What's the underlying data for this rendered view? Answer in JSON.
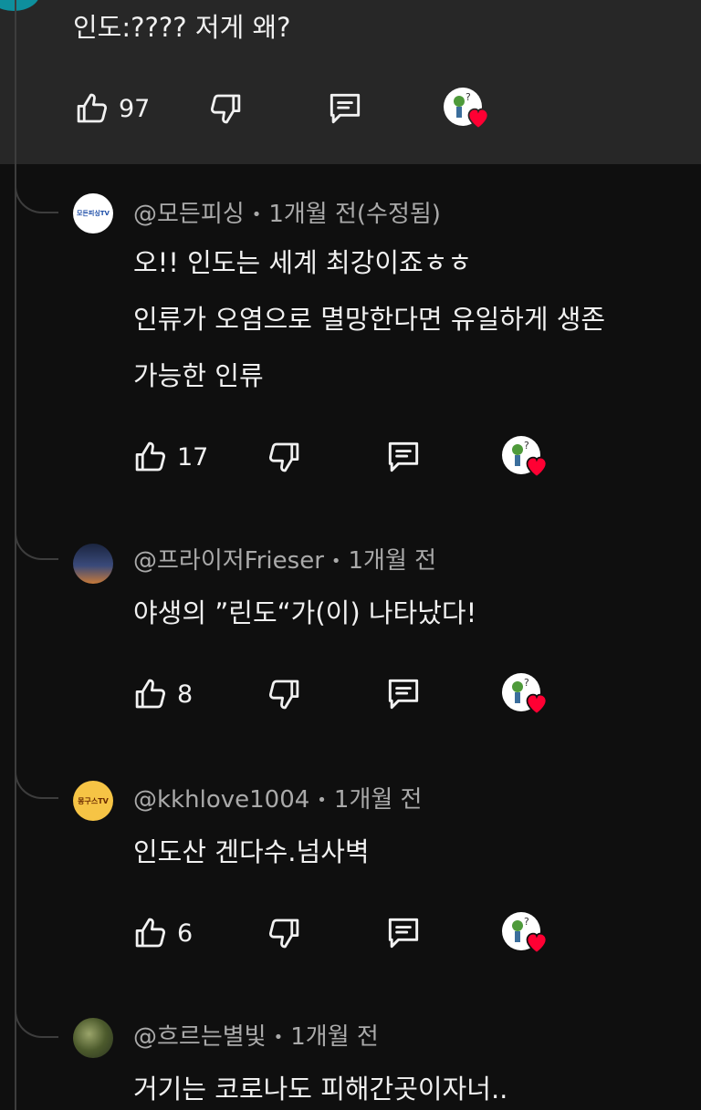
{
  "parent": {
    "text": "인도:????  저게 왜?",
    "likes": "97"
  },
  "replies": [
    {
      "author": "@모든피싱",
      "time": "1개월 전(수정됨)",
      "avatar_label": "모든피싱TV",
      "lines": [
        "오!! 인도는 세계 최강이죠ㅎㅎ",
        "인류가 오염으로 멸망한다면 유일하게 생존",
        "가능한 인류"
      ],
      "likes": "17"
    },
    {
      "author": "@프라이저Frieser",
      "time": "1개월 전",
      "lines": [
        "야생의 ”린도“가(이) 나타났다!"
      ],
      "likes": "8"
    },
    {
      "author": "@kkhlove1004",
      "time": "1개월 전",
      "avatar_label": "몽구스TV",
      "lines": [
        "인도산 겐다수.넘사벽"
      ],
      "likes": "6"
    },
    {
      "author": "@흐르는별빛",
      "time": "1개월 전",
      "lines": [
        "거기는 코로나도 피해간곳이자너.."
      ]
    }
  ],
  "separator": "•",
  "icons": {
    "like": "thumbs-up-icon",
    "dislike": "thumbs-down-icon",
    "reply": "comment-icon",
    "creator_heart": "creator-heart-icon"
  },
  "colors": {
    "background": "#0f0f0f",
    "highlight": "#272727",
    "heart": "#ff0033",
    "meta_text": "#aaaaaa"
  }
}
